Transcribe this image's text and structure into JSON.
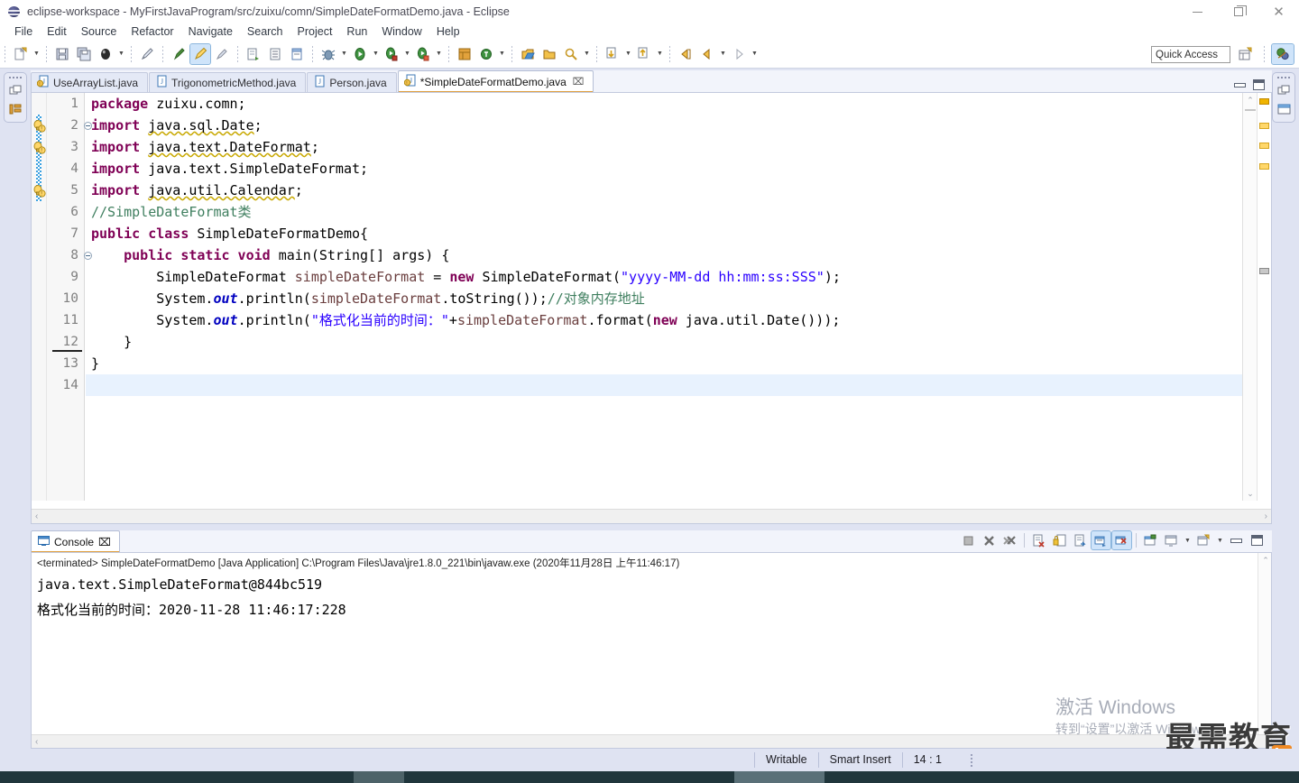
{
  "window": {
    "title": "eclipse-workspace - MyFirstJavaProgram/src/zuixu/comn/SimpleDateFormatDemo.java - Eclipse",
    "icon": "eclipse-icon",
    "minimize_label": "—",
    "maximize_label": "❐",
    "close_label": "✕"
  },
  "menu": {
    "items": [
      {
        "label": "File"
      },
      {
        "label": "Edit"
      },
      {
        "label": "Source"
      },
      {
        "label": "Refactor"
      },
      {
        "label": "Navigate"
      },
      {
        "label": "Search"
      },
      {
        "label": "Project"
      },
      {
        "label": "Run"
      },
      {
        "label": "Window"
      },
      {
        "label": "Help"
      }
    ]
  },
  "toolbar": {
    "quick_access_placeholder": "Quick Access",
    "quick_access_value": "",
    "buttons": [
      {
        "name": "new-wizard-icon",
        "has_arrow": true
      },
      {
        "name": "save-icon",
        "has_arrow": false
      },
      {
        "name": "save-all-icon",
        "has_arrow": false
      },
      {
        "name": "print-icon",
        "has_arrow": true
      },
      {
        "name": "undo-pen-icon",
        "has_arrow": false
      },
      {
        "name": "toggle-mark-occurrences-icon",
        "has_arrow": false
      },
      {
        "name": "pencil-highlight-icon",
        "has_arrow": false
      },
      {
        "name": "skip-all-breakpoints-icon",
        "has_arrow": false
      },
      {
        "name": "next-annotation-icon",
        "has_arrow": false
      },
      {
        "name": "open-type-icon",
        "has_arrow": false
      },
      {
        "name": "open-task-icon",
        "has_arrow": false
      },
      {
        "name": "debug-bug-icon",
        "has_arrow": true
      },
      {
        "name": "run-icon",
        "has_arrow": true
      },
      {
        "name": "run-external-tools-icon",
        "has_arrow": true
      },
      {
        "name": "run-coverage-icon",
        "has_arrow": true
      },
      {
        "name": "new-java-package-icon",
        "has_arrow": false
      },
      {
        "name": "new-java-class-icon",
        "has_arrow": true
      },
      {
        "name": "open-perspective-icon",
        "has_arrow": false
      },
      {
        "name": "search-folder-icon",
        "has_arrow": false
      },
      {
        "name": "search-icon",
        "has_arrow": true
      },
      {
        "name": "previous-edit-icon",
        "has_arrow": true
      },
      {
        "name": "next-edit-icon",
        "has_arrow": true
      },
      {
        "name": "back-icon",
        "has_arrow": false
      },
      {
        "name": "forward-icon",
        "has_arrow": true
      },
      {
        "name": "forward-nav-icon",
        "has_arrow": true
      }
    ],
    "perspective_new": "open-perspective-button",
    "perspective_java": "java-perspective-button"
  },
  "editor": {
    "tabs": [
      {
        "label": "UseArrayList.java",
        "icon": "java-file-warning-icon",
        "active": false,
        "dirty": false,
        "closeable": false
      },
      {
        "label": "TrigonometricMethod.java",
        "icon": "java-file-icon",
        "active": false,
        "dirty": false,
        "closeable": false
      },
      {
        "label": "Person.java",
        "icon": "java-file-icon",
        "active": false,
        "dirty": false,
        "closeable": false
      },
      {
        "label": "*SimpleDateFormatDemo.java",
        "icon": "java-file-warning-icon",
        "active": true,
        "dirty": true,
        "closeable": true,
        "close_glyph": "⌧"
      }
    ],
    "minimize_label": "minimize-editor",
    "maximize_label": "maximize-editor",
    "lines": [
      {
        "n": "1",
        "fold": false,
        "warn": false,
        "change": false,
        "current": false,
        "html": "<span class=\"kw\">package</span> zuixu.comn;"
      },
      {
        "n": "2",
        "fold": true,
        "warn": true,
        "change": true,
        "current": false,
        "html": "<span class=\"kw\">import</span> <span class=\"sq\">java.sql.Date</span>;"
      },
      {
        "n": "3",
        "fold": false,
        "warn": true,
        "change": true,
        "current": false,
        "html": "<span class=\"kw\">import</span> <span class=\"sq\">java.text.DateFormat</span>;"
      },
      {
        "n": "4",
        "fold": false,
        "warn": false,
        "change": true,
        "current": false,
        "html": "<span class=\"kw\">import</span> java.text.SimpleDateFormat;"
      },
      {
        "n": "5",
        "fold": false,
        "warn": true,
        "change": true,
        "current": false,
        "html": "<span class=\"kw\">import</span> <span class=\"sq\">java.util.Calendar</span>;"
      },
      {
        "n": "6",
        "fold": false,
        "warn": false,
        "change": false,
        "current": false,
        "html": "<span class=\"cmt\">//SimpleDateFormat类</span>"
      },
      {
        "n": "7",
        "fold": false,
        "warn": false,
        "change": false,
        "current": false,
        "html": "<span class=\"kw\">public class</span> SimpleDateFormatDemo{"
      },
      {
        "n": "8",
        "fold": true,
        "warn": false,
        "change": false,
        "current": false,
        "html": "    <span class=\"kw\">public static void</span> main(String[] args) {"
      },
      {
        "n": "9",
        "fold": false,
        "warn": false,
        "change": false,
        "current": false,
        "html": "        SimpleDateFormat <span class=\"loc\">simpleDateFormat</span> = <span class=\"kw\">new</span> SimpleDateFormat(<span class=\"str\">\"yyyy-MM-dd hh:mm:ss:SSS\"</span>);"
      },
      {
        "n": "10",
        "fold": false,
        "warn": false,
        "change": false,
        "current": false,
        "html": "        System.<span class=\"fld\">out</span>.println(<span class=\"loc\">simpleDateFormat</span>.toString());<span class=\"cmt\">//对象内存地址</span>"
      },
      {
        "n": "11",
        "fold": false,
        "warn": false,
        "change": false,
        "current": false,
        "html": "        System.<span class=\"fld\">out</span>.println(<span class=\"str\">\"格式化当前的时间：\"</span>+<span class=\"loc\">simpleDateFormat</span>.format(<span class=\"kw\">new</span> java.util.Date()));"
      },
      {
        "n": "12",
        "fold": false,
        "warn": false,
        "change": false,
        "current": false,
        "underlined": true,
        "html": "    }"
      },
      {
        "n": "13",
        "fold": false,
        "warn": false,
        "change": false,
        "current": false,
        "html": "}"
      },
      {
        "n": "14",
        "fold": false,
        "warn": false,
        "change": false,
        "current": true,
        "html": ""
      }
    ],
    "scroll_left_glyph": "‹",
    "scroll_right_glyph": "›",
    "scroll_up_glyph": "⌃",
    "scroll_down_glyph": "⌄"
  },
  "console": {
    "tab_label": "Console",
    "tab_icon": "console-icon",
    "tab_close_glyph": "⌧",
    "header": "<terminated> SimpleDateFormatDemo [Java Application] C:\\Program Files\\Java\\jre1.8.0_221\\bin\\javaw.exe (2020年11月28日 上午11:46:17)",
    "output_lines": [
      "java.text.SimpleDateFormat@844bc519",
      "格式化当前的时间：2020-11-28 11:46:17:228"
    ],
    "tools": [
      {
        "name": "terminate-icon",
        "active": false
      },
      {
        "name": "remove-launch-icon",
        "active": false
      },
      {
        "name": "remove-all-terminated-icon",
        "active": false
      },
      {
        "name": "clear-console-icon",
        "active": false
      },
      {
        "name": "scroll-lock-icon",
        "active": false
      },
      {
        "name": "word-wrap-icon",
        "active": false
      },
      {
        "name": "show-console-on-output-icon",
        "active": true
      },
      {
        "name": "show-console-on-error-icon",
        "active": true
      },
      {
        "name": "pin-console-icon",
        "active": false
      },
      {
        "name": "display-selected-console-icon",
        "active": false
      },
      {
        "name": "open-console-icon",
        "active": false
      }
    ],
    "minimize_label": "minimize-console",
    "maximize_label": "maximize-console",
    "scroll_left_glyph": "‹"
  },
  "status": {
    "writable": "Writable",
    "insert_mode": "Smart Insert",
    "cursor_position": "14 : 1"
  },
  "watermark": {
    "activate_line1": "激活 Windows",
    "activate_line2": "转到“设置”以激活 Windows。",
    "brand": "最需教育"
  },
  "colors": {
    "accent": "#e0a040",
    "keyword": "#7f0055",
    "string": "#2a00ff",
    "comment": "#3f7f5f",
    "field": "#0000c0",
    "local_var": "#6a3e3e",
    "selection": "#e8f2fe",
    "chrome": "#dfe3f2"
  }
}
